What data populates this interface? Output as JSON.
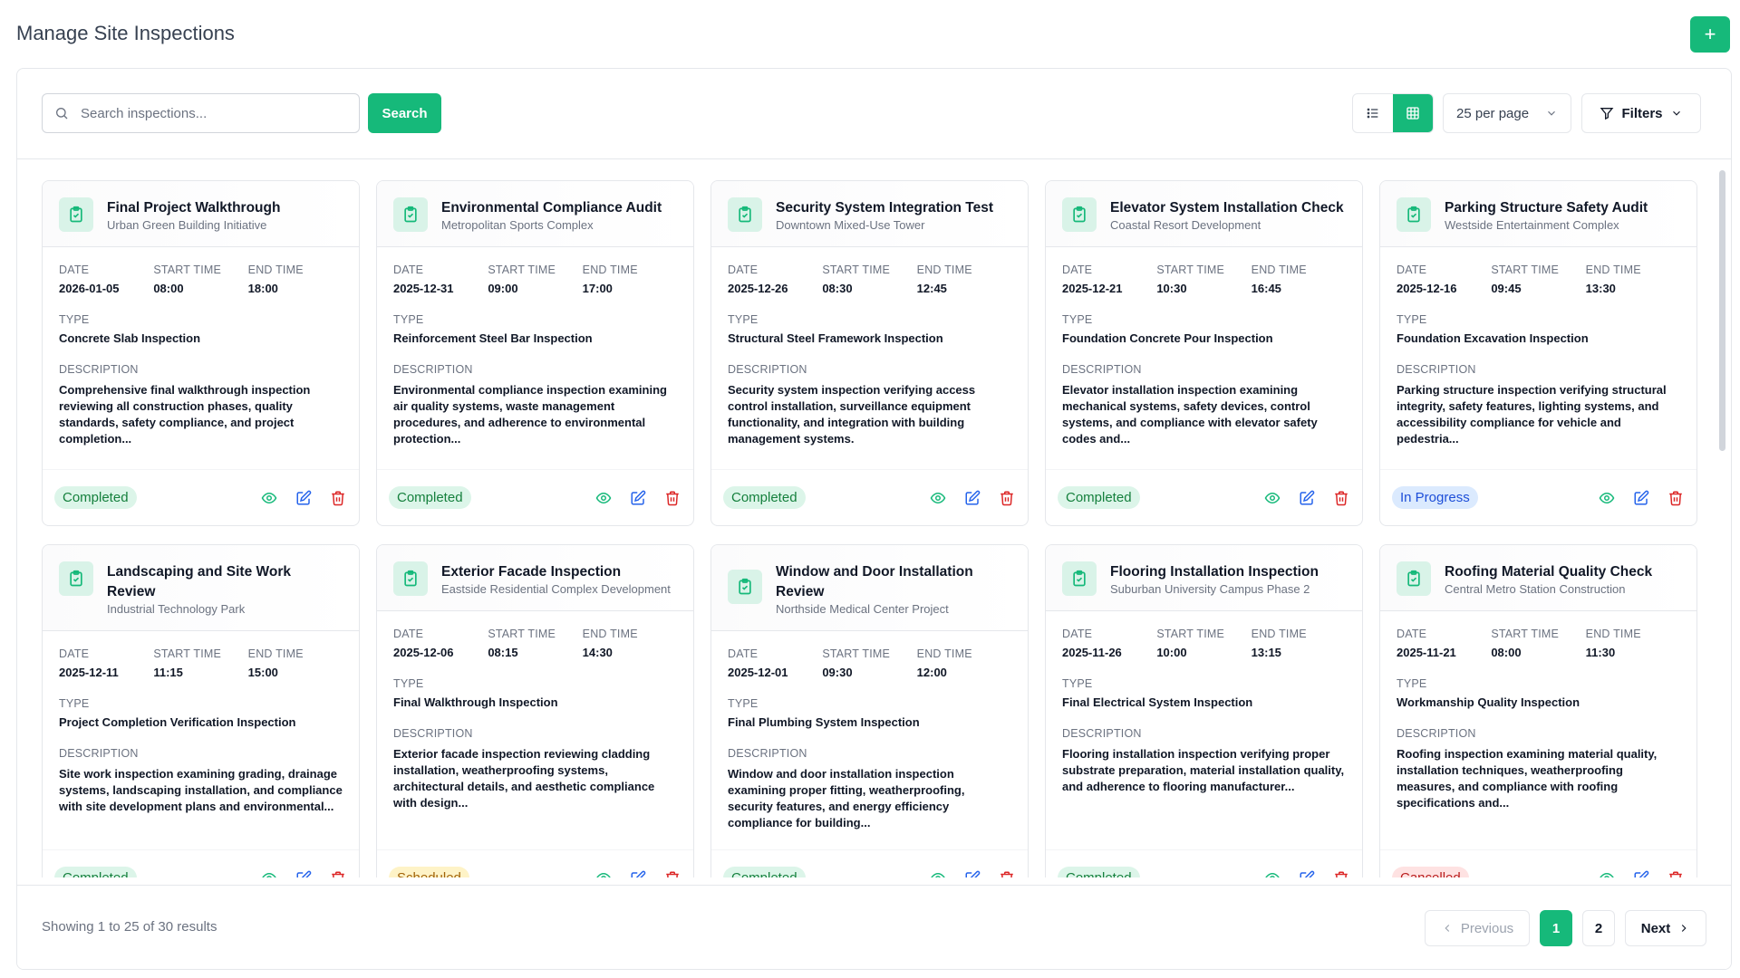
{
  "page": {
    "title": "Manage Site Inspections",
    "add_label": "+"
  },
  "toolbar": {
    "search_placeholder": "Search inspections...",
    "search_label": "Search",
    "per_page": "25 per page",
    "filters_label": "Filters",
    "view_mode": "grid"
  },
  "labels": {
    "date": "DATE",
    "start": "START TIME",
    "end": "END TIME",
    "type": "TYPE",
    "description": "DESCRIPTION"
  },
  "colors": {
    "accent": "#16b97a",
    "completed": "#15803d",
    "in_progress": "#1d4ed8",
    "scheduled": "#a16207",
    "cancelled": "#b91c1c"
  },
  "cards": [
    {
      "title": "Final Project Walkthrough",
      "project": "Urban Green Building Initiative",
      "date": "2026-01-05",
      "start": "08:00",
      "end": "18:00",
      "type": "Concrete Slab Inspection",
      "description": "Comprehensive final walkthrough inspection reviewing all construction phases, quality standards, safety compliance, and project completion...",
      "status": "Completed",
      "status_class": "completed"
    },
    {
      "title": "Environmental Compliance Audit",
      "project": "Metropolitan Sports Complex",
      "date": "2025-12-31",
      "start": "09:00",
      "end": "17:00",
      "type": "Reinforcement Steel Bar Inspection",
      "description": "Environmental compliance inspection examining air quality systems, waste management procedures, and adherence to environmental protection...",
      "status": "Completed",
      "status_class": "completed"
    },
    {
      "title": "Security System Integration Test",
      "project": "Downtown Mixed-Use Tower",
      "date": "2025-12-26",
      "start": "08:30",
      "end": "12:45",
      "type": "Structural Steel Framework Inspection",
      "description": "Security system inspection verifying access control installation, surveillance equipment functionality, and integration with building management systems.",
      "status": "Completed",
      "status_class": "completed"
    },
    {
      "title": "Elevator System Installation Check",
      "project": "Coastal Resort Development",
      "date": "2025-12-21",
      "start": "10:30",
      "end": "16:45",
      "type": "Foundation Concrete Pour Inspection",
      "description": "Elevator installation inspection examining mechanical systems, safety devices, control systems, and compliance with elevator safety codes and...",
      "status": "Completed",
      "status_class": "completed"
    },
    {
      "title": "Parking Structure Safety Audit",
      "project": "Westside Entertainment Complex",
      "date": "2025-12-16",
      "start": "09:45",
      "end": "13:30",
      "type": "Foundation Excavation Inspection",
      "description": "Parking structure inspection verifying structural integrity, safety features, lighting systems, and accessibility compliance for vehicle and pedestria...",
      "status": "In Progress",
      "status_class": "progress"
    },
    {
      "title": "Landscaping and Site Work Review",
      "project": "Industrial Technology Park",
      "date": "2025-12-11",
      "start": "11:15",
      "end": "15:00",
      "type": "Project Completion Verification Inspection",
      "description": "Site work inspection examining grading, drainage systems, landscaping installation, and compliance with site development plans and environmental...",
      "status": "Completed",
      "status_class": "completed"
    },
    {
      "title": "Exterior Facade Inspection",
      "project": "Eastside Residential Complex Development",
      "date": "2025-12-06",
      "start": "08:15",
      "end": "14:30",
      "type": "Final Walkthrough Inspection",
      "description": "Exterior facade inspection reviewing cladding installation, weatherproofing systems, architectural details, and aesthetic compliance with design...",
      "status": "Scheduled",
      "status_class": "scheduled"
    },
    {
      "title": "Window and Door Installation Review",
      "project": "Northside Medical Center Project",
      "date": "2025-12-01",
      "start": "09:30",
      "end": "12:00",
      "type": "Final Plumbing System Inspection",
      "description": "Window and door installation inspection examining proper fitting, weatherproofing, security features, and energy efficiency compliance for building...",
      "status": "Completed",
      "status_class": "completed"
    },
    {
      "title": "Flooring Installation Inspection",
      "project": "Suburban University Campus Phase 2",
      "date": "2025-11-26",
      "start": "10:00",
      "end": "13:15",
      "type": "Final Electrical System Inspection",
      "description": "Flooring installation inspection verifying proper substrate preparation, material installation quality, and adherence to flooring manufacturer...",
      "status": "Completed",
      "status_class": "completed"
    },
    {
      "title": "Roofing Material Quality Check",
      "project": "Central Metro Station Construction",
      "date": "2025-11-21",
      "start": "08:00",
      "end": "11:30",
      "type": "Workmanship Quality Inspection",
      "description": "Roofing inspection examining material quality, installation techniques, weatherproofing measures, and compliance with roofing specifications and...",
      "status": "Cancelled",
      "status_class": "cancelled"
    }
  ],
  "footer": {
    "showing": "Showing 1 to 25 of 30 results",
    "previous": "Previous",
    "next": "Next",
    "pages": [
      "1",
      "2"
    ],
    "current_page": "1"
  }
}
